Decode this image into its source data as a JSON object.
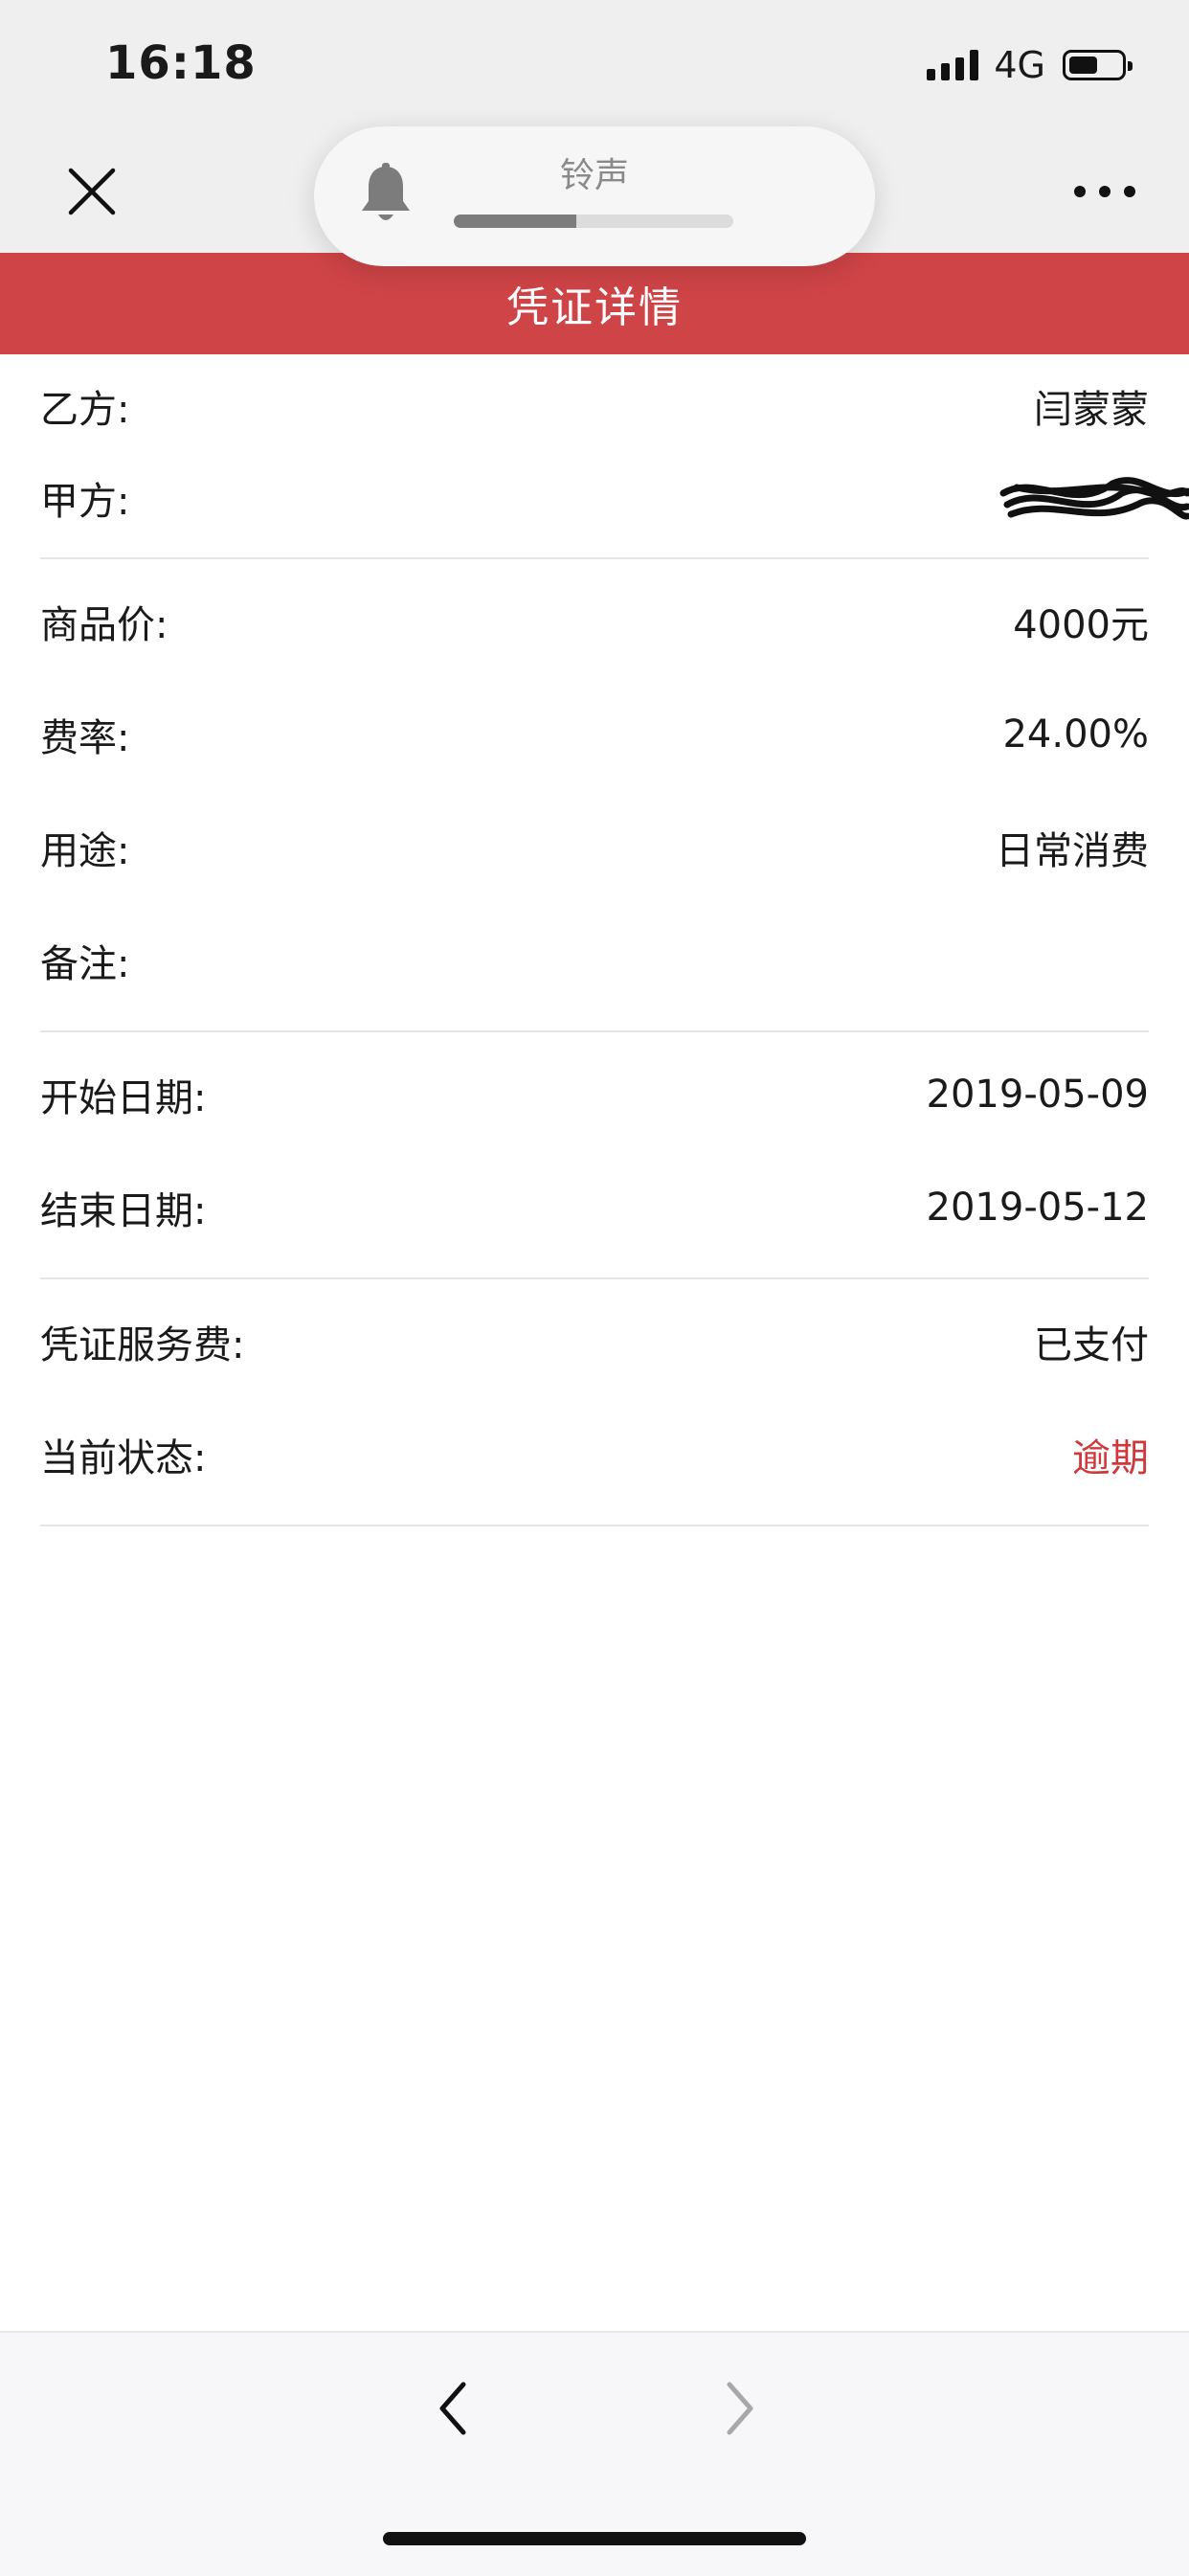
{
  "status_bar": {
    "time": "16:18",
    "network": "4G",
    "battery_level": 0.55,
    "signal_icon": "signal-bars-icon",
    "battery_icon": "battery-icon"
  },
  "nav": {
    "close_icon": "close-icon",
    "more_icon": "more-dots-icon"
  },
  "ringer": {
    "label": "铃声",
    "volume": 0.44,
    "icon": "bell-icon"
  },
  "page": {
    "title": "凭证详情"
  },
  "details": {
    "party_b": {
      "label": "乙方:",
      "value": "闫蒙蒙"
    },
    "party_a": {
      "label": "甲方:",
      "value": ""
    },
    "price": {
      "label": "商品价:",
      "value": "4000元"
    },
    "rate": {
      "label": "费率:",
      "value": "24.00%"
    },
    "usage": {
      "label": "用途:",
      "value": "日常消费"
    },
    "remark": {
      "label": "备注:",
      "value": ""
    },
    "start_date": {
      "label": "开始日期:",
      "value": "2019-05-09"
    },
    "end_date": {
      "label": "结束日期:",
      "value": "2019-05-12"
    },
    "service_fee": {
      "label": "凭证服务费:",
      "value": "已支付"
    },
    "status": {
      "label": "当前状态:",
      "value": "逾期",
      "color": "#d0393b"
    }
  },
  "bottom_nav": {
    "back_icon": "chevron-left-icon",
    "forward_icon": "chevron-right-icon"
  }
}
